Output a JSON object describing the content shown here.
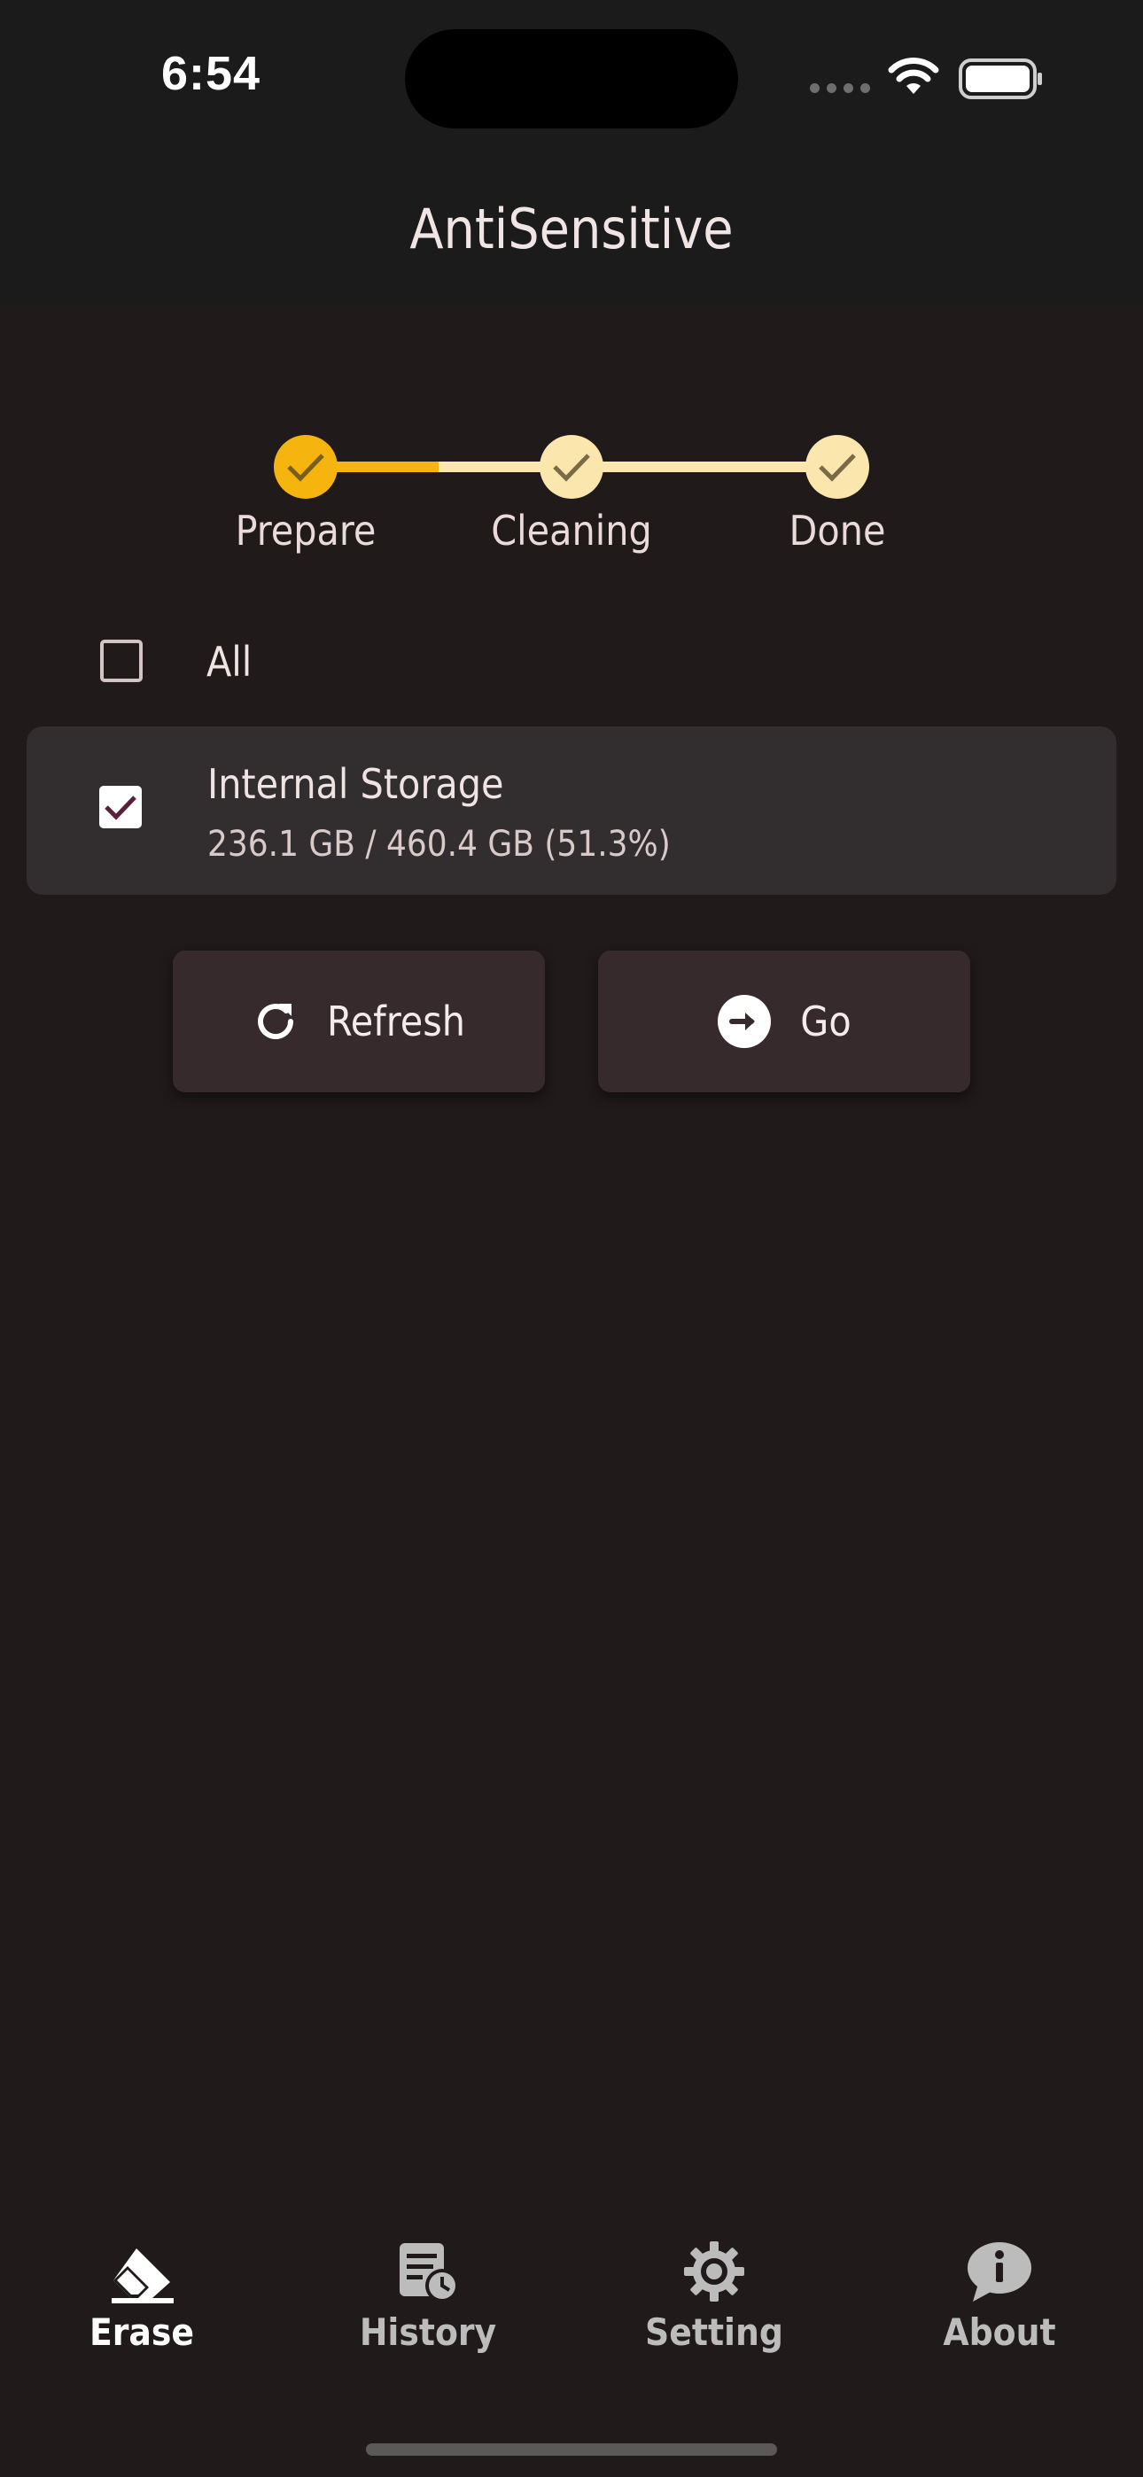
{
  "status_bar": {
    "time": "6:54"
  },
  "app_bar": {
    "title": "AntiSensitive"
  },
  "stepper": {
    "steps": [
      {
        "label": "Prepare",
        "state": "active"
      },
      {
        "label": "Cleaning",
        "state": "pending"
      },
      {
        "label": "Done",
        "state": "pending"
      }
    ],
    "colors": {
      "active": "#f5b50e",
      "pending": "#fbe7ae",
      "check": "#7a6a46"
    }
  },
  "select_all": {
    "label": "All",
    "checked": false
  },
  "storage": {
    "name": "Internal Storage",
    "usage": "236.1 GB / 460.4 GB (51.3%)",
    "checked": true
  },
  "actions": {
    "refresh_label": "Refresh",
    "go_label": "Go"
  },
  "bottom_nav": {
    "items": [
      {
        "label": "Erase",
        "icon": "eraser-icon",
        "selected": true
      },
      {
        "label": "History",
        "icon": "history-icon",
        "selected": false
      },
      {
        "label": "Setting",
        "icon": "gear-icon",
        "selected": false
      },
      {
        "label": "About",
        "icon": "info-icon",
        "selected": false
      }
    ]
  }
}
